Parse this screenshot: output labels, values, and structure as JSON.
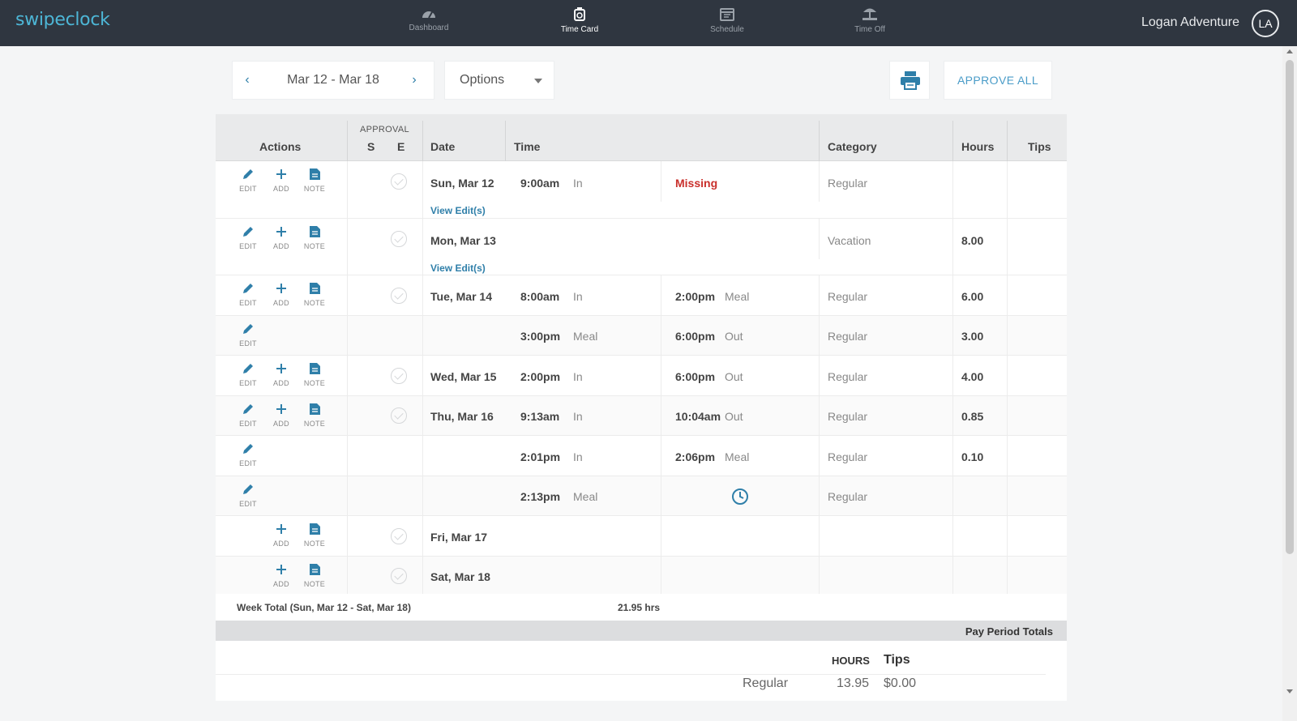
{
  "app": {
    "logo": "swipeclock"
  },
  "nav": [
    {
      "label": "Dashboard",
      "icon": "dashboard-icon",
      "active": false
    },
    {
      "label": "Time Card",
      "icon": "timecard-icon",
      "active": true
    },
    {
      "label": "Schedule",
      "icon": "calendar-icon",
      "active": false
    },
    {
      "label": "Time Off",
      "icon": "beach-icon",
      "active": false
    }
  ],
  "user": {
    "name": "Logan Adventure",
    "initials": "LA"
  },
  "toolbar": {
    "prev": "‹",
    "next": "›",
    "date_range": "Mar 12 - Mar 18",
    "options_label": "Options",
    "approve_all": "APPROVE ALL"
  },
  "table": {
    "headers": {
      "actions": "Actions",
      "approval": "APPROVAL",
      "s": "S",
      "e": "E",
      "date": "Date",
      "time": "Time",
      "category": "Category",
      "hours": "Hours",
      "tips": "Tips"
    },
    "action_labels": {
      "edit": "EDIT",
      "add": "ADD",
      "note": "NOTE"
    },
    "view_edits": "View Edit(s)",
    "rows": [
      {
        "date": "Sun, Mar 12",
        "in_time": "9:00am",
        "in_type": "In",
        "out_time": "",
        "out_type": "",
        "missing": "Missing",
        "category": "Regular",
        "hours": ""
      },
      {
        "date": "Mon, Mar 13",
        "in_time": "",
        "in_type": "",
        "out_time": "",
        "out_type": "",
        "category": "Vacation",
        "hours": "8.00"
      },
      {
        "date": "Tue, Mar 14",
        "in_time": "8:00am",
        "in_type": "In",
        "out_time": "2:00pm",
        "out_type": "Meal",
        "category": "Regular",
        "hours": "6.00"
      },
      {
        "date": "",
        "in_time": "3:00pm",
        "in_type": "Meal",
        "out_time": "6:00pm",
        "out_type": "Out",
        "category": "Regular",
        "hours": "3.00"
      },
      {
        "date": "Wed, Mar 15",
        "in_time": "2:00pm",
        "in_type": "In",
        "out_time": "6:00pm",
        "out_type": "Out",
        "category": "Regular",
        "hours": "4.00"
      },
      {
        "date": "Thu, Mar 16",
        "in_time": "9:13am",
        "in_type": "In",
        "out_time": "10:04am",
        "out_type": "Out",
        "category": "Regular",
        "hours": "0.85"
      },
      {
        "date": "",
        "in_time": "2:01pm",
        "in_type": "In",
        "out_time": "2:06pm",
        "out_type": "Meal",
        "category": "Regular",
        "hours": "0.10"
      },
      {
        "date": "",
        "in_time": "2:13pm",
        "in_type": "Meal",
        "out_time": "",
        "out_type": "",
        "category": "Regular",
        "hours": ""
      },
      {
        "date": "Fri, Mar 17",
        "in_time": "",
        "in_type": "",
        "out_time": "",
        "out_type": "",
        "category": "",
        "hours": ""
      },
      {
        "date": "Sat, Mar 18",
        "in_time": "",
        "in_type": "",
        "out_time": "",
        "out_type": "",
        "category": "",
        "hours": ""
      }
    ],
    "week_total_label": "Week Total (Sun, Mar 12 - Sat, Mar 18)",
    "week_total_value": "21.95 hrs"
  },
  "pay_period": {
    "title": "Pay Period Totals",
    "hours_header": "HOURS",
    "tips_header": "Tips",
    "rows": [
      {
        "category": "Regular",
        "hours": "13.95",
        "tips": "$0.00"
      }
    ]
  },
  "colors": {
    "topbar": "#2f3640",
    "accent": "#2f7fa9",
    "missing": "#c9302c",
    "logo": "#4db6d6"
  }
}
